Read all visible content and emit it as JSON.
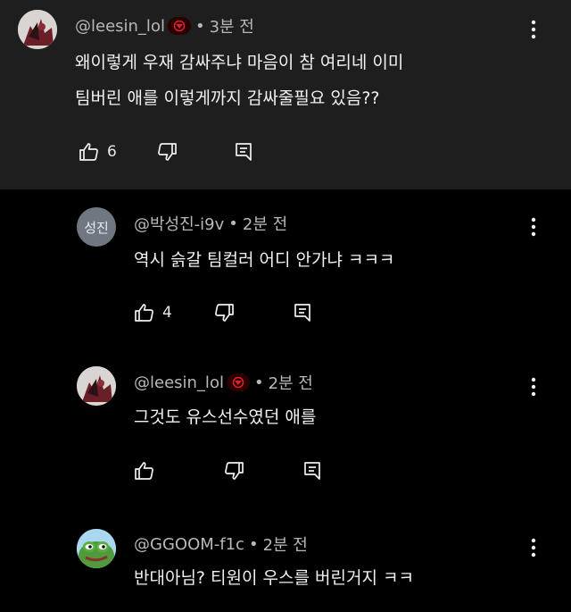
{
  "comments": [
    {
      "author": "@leesin_lol",
      "time": "3분 전",
      "lines": [
        "왜이렇게 우재 감싸주냐 마음이 참 여리네 이미",
        "팀버린 애를 이렇게까지 감싸줄필요 있음??"
      ],
      "likes": "6",
      "badge": "T1-logo-icon",
      "avatar": "illustrated-character-avatar"
    },
    {
      "author": "@박성진-i9v",
      "time": "2분 전",
      "lines": [
        "역시 슭갈 팀컬러 어디 안가냐 ㅋㅋㅋ"
      ],
      "likes": "4",
      "avatar_text": "성진"
    },
    {
      "author": "@leesin_lol",
      "time": "2분 전",
      "lines": [
        "그것도 유스선수였던 애를"
      ],
      "likes": "",
      "badge": "T1-logo-icon",
      "avatar": "illustrated-character-avatar"
    },
    {
      "author": "@GGOOM-f1c",
      "time": "2분 전",
      "lines": [
        "반대아님? 티원이 우스를 버린거지 ㅋㅋ"
      ],
      "likes": "",
      "avatar": "pepe-frog-avatar"
    }
  ],
  "separator": "•",
  "colors": {
    "top_background": "#1e1e1e",
    "reply_background": "#000000",
    "badge_red": "#e3202d",
    "meta_text": "#b8b8b8"
  },
  "icons": [
    "thumb-up-icon",
    "thumb-down-icon",
    "reply-icon",
    "more-vert-icon"
  ]
}
